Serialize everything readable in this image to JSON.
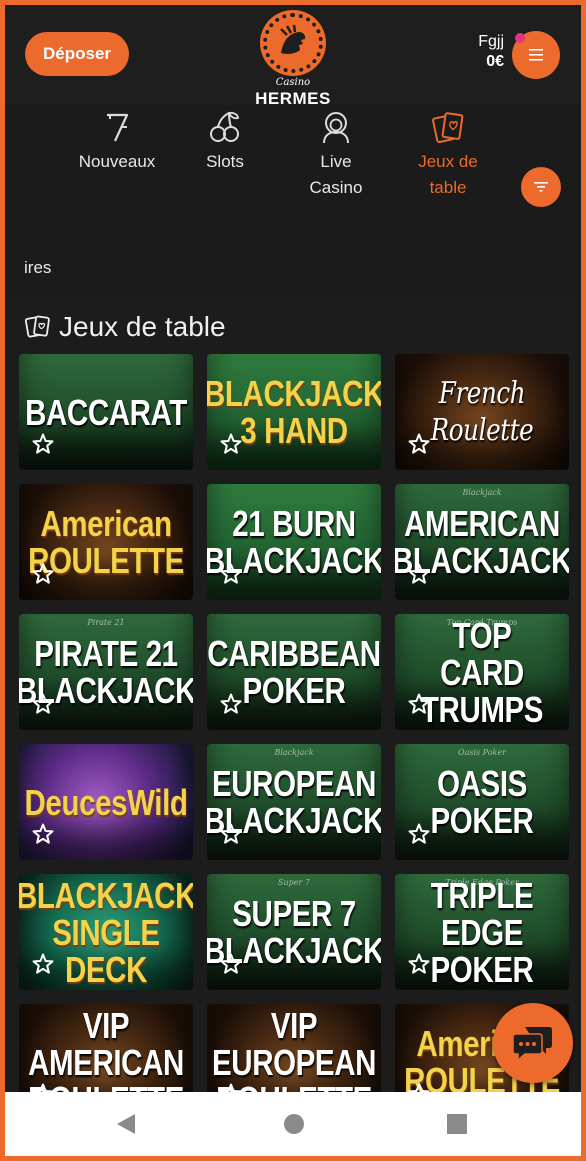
{
  "header": {
    "deposit_label": "Déposer",
    "logo_top": "Casino",
    "logo_bottom": "HERMES",
    "username": "Fgjj",
    "balance": "0€",
    "menu_icon": "hamburger-icon"
  },
  "categories": [
    {
      "label": "ires",
      "icon": "none"
    },
    {
      "label": "Nouveaux",
      "icon": "seven-icon"
    },
    {
      "label": "Slots",
      "icon": "cherries-icon"
    },
    {
      "label": "Live Casino",
      "icon": "dealer-icon"
    },
    {
      "label": "Jeux de table",
      "icon": "cards-icon",
      "active": true
    }
  ],
  "filter_icon": "filter-icon",
  "section": {
    "title": "Jeux de table",
    "icon": "cards-icon"
  },
  "games": [
    {
      "title": "BACCARAT",
      "felt": ""
    },
    {
      "title": "BLACKJACK 3 HAND",
      "felt": ""
    },
    {
      "title": "French Roulette",
      "felt": ""
    },
    {
      "title": "American ROULETTE",
      "felt": ""
    },
    {
      "title": "21 BURN BLACKJACK",
      "felt": ""
    },
    {
      "title": "AMERICAN BLACKJACK",
      "felt": "Blackjack"
    },
    {
      "title": "PIRATE 21 BLACKJACK",
      "felt": "Pirate 21"
    },
    {
      "title": "CARIBBEAN POKER",
      "felt": ""
    },
    {
      "title": "TOP CARD TRUMPS",
      "felt": "Top Card Trumps"
    },
    {
      "title": "DeucesWild",
      "felt": ""
    },
    {
      "title": "EUROPEAN BLACKJACK",
      "felt": "Blackjack"
    },
    {
      "title": "OASIS POKER",
      "felt": "Oasis Poker"
    },
    {
      "title": "BLACKJACK SINGLE DECK",
      "felt": ""
    },
    {
      "title": "SUPER 7 BLACKJACK",
      "felt": "Super 7"
    },
    {
      "title": "TRIPLE EDGE POKER",
      "felt": "Triple Edge Poker"
    },
    {
      "title": "VIP AMERICAN ROULETTE",
      "felt": ""
    },
    {
      "title": "VIP EUROPEAN ROULETTE",
      "felt": ""
    },
    {
      "title": "American ROULETTE",
      "felt": ""
    }
  ],
  "chat_icon": "chat-icon",
  "android_nav": [
    "back-icon",
    "home-icon",
    "recents-icon"
  ],
  "colors": {
    "accent": "#ec6a2c",
    "background": "#1c1c1c",
    "notification": "#e8337e"
  }
}
